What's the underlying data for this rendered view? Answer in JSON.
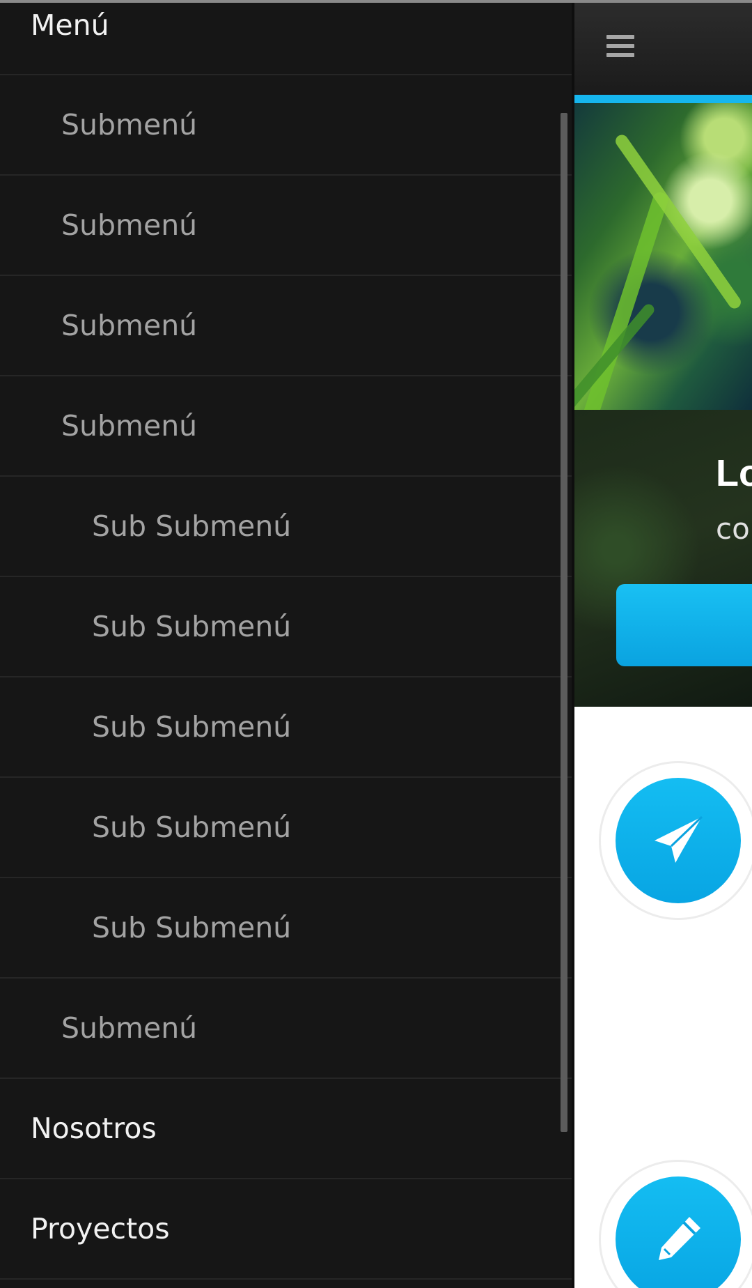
{
  "drawer": {
    "items": [
      {
        "label": "Menú",
        "level": 0
      },
      {
        "label": "Submenú",
        "level": 1
      },
      {
        "label": "Submenú",
        "level": 1
      },
      {
        "label": "Submenú",
        "level": 1
      },
      {
        "label": "Submenú",
        "level": 1
      },
      {
        "label": "Sub Submenú",
        "level": 2
      },
      {
        "label": "Sub Submenú",
        "level": 2
      },
      {
        "label": "Sub Submenú",
        "level": 2
      },
      {
        "label": "Sub Submenú",
        "level": 2
      },
      {
        "label": "Sub Submenú",
        "level": 2
      },
      {
        "label": "Submenú",
        "level": 1
      },
      {
        "label": "Nosotros",
        "level": 0
      },
      {
        "label": "Proyectos",
        "level": 0
      }
    ]
  },
  "main": {
    "menu_icon": "hamburger-icon",
    "hero": {
      "title": "Lo",
      "subtitle": "co"
    },
    "features": [
      {
        "icon": "paper-plane-icon"
      },
      {
        "icon": "pencil-icon"
      }
    ],
    "colors": {
      "accent": "#16b6ee",
      "drawer_bg": "#161616"
    }
  }
}
